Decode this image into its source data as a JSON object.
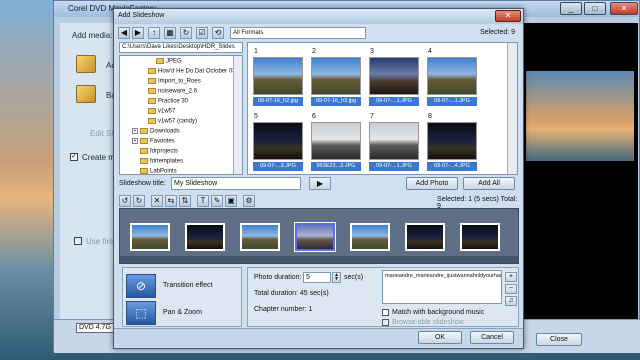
{
  "app": {
    "title": "Corel DVD MovieFactory",
    "add_media_label": "Add media:",
    "add_label": "Add",
    "ba_label": "Ba",
    "edit_slide_label": "Edit Sli",
    "create_label": "Create m",
    "use_first_label": "Use first",
    "dvd_label": "DVD 4.7G",
    "close_button": "Close"
  },
  "dialog": {
    "title": "Add Slideshow",
    "format_filter": "All Formats",
    "selected_count": "Selected: 9",
    "path": "C:\\Users\\Dave Likes\\Desktop\\HDR_Slides",
    "tree_items": [
      {
        "label": "JPEG",
        "indent": 3,
        "expander": ""
      },
      {
        "label": "How'd He Do Dat October 03",
        "indent": 2,
        "expander": ""
      },
      {
        "label": "Import_to_Roes",
        "indent": 2,
        "expander": ""
      },
      {
        "label": "noiseware_2.6",
        "indent": 2,
        "expander": ""
      },
      {
        "label": "Practice 30",
        "indent": 2,
        "expander": ""
      },
      {
        "label": "v1w57",
        "indent": 2,
        "expander": ""
      },
      {
        "label": "v1w57 (candy)",
        "indent": 2,
        "expander": ""
      },
      {
        "label": "Downloads",
        "indent": 1,
        "expander": "+"
      },
      {
        "label": "Favorites",
        "indent": 1,
        "expander": "+"
      },
      {
        "label": "fdrprojects",
        "indent": 1,
        "expander": ""
      },
      {
        "label": "fdrtemplates",
        "indent": 1,
        "expander": ""
      },
      {
        "label": "LabPoints",
        "indent": 1,
        "expander": ""
      }
    ],
    "thumbnails": [
      {
        "number": "1",
        "label": "09-07-16_h2.jpg",
        "tone": "day"
      },
      {
        "number": "2",
        "label": "09-07-16_h3.jpg",
        "tone": "day"
      },
      {
        "number": "3",
        "label": "09-07-...1.JPG",
        "tone": "dusk"
      },
      {
        "number": "4",
        "label": "09-07-...1.JPG",
        "tone": "day"
      },
      {
        "number": "5",
        "label": "09-07-...3.JPG",
        "tone": "night"
      },
      {
        "number": "6",
        "label": "993E23...3.JPG",
        "tone": "overcast"
      },
      {
        "number": "7",
        "label": "09-07-...1.JPG",
        "tone": "overcast"
      },
      {
        "number": "8",
        "label": "09-07-...4.JPG",
        "tone": "night"
      }
    ],
    "slideshow_title_label": "Slideshow title:",
    "slideshow_title_value": "My Slideshow",
    "add_photo_button": "Add Photo",
    "add_all_button": "Add All",
    "selection_info": "Selected: 1 (5 secs)  Total: 9",
    "filmstrip": [
      "day",
      "night",
      "day",
      "selected",
      "day",
      "night",
      "night"
    ],
    "transition_effect_label": "Transition effect",
    "pan_zoom_label": "Pan & Zoom",
    "photo_duration_label": "Photo duration:",
    "photo_duration_value": "5",
    "photo_duration_unit": "sec(s)",
    "total_duration": "Total duration: 45 sec(s)",
    "chapter_number": "Chapter number: 1",
    "caption_text": "marieandre_marieandre_ijustwannaholdyourhandie",
    "match_music_label": "Match with background music",
    "browsable_label": "Browse-able slideshow",
    "ok_button": "OK",
    "cancel_button": "Cancel"
  }
}
